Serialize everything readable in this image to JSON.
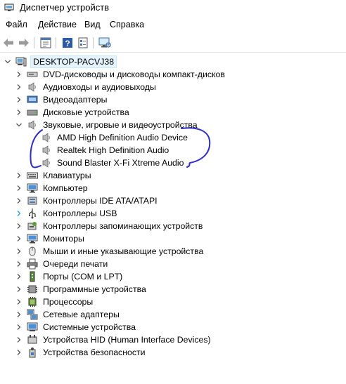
{
  "window": {
    "title": "Диспетчер устройств"
  },
  "menu": [
    {
      "label": "Файл"
    },
    {
      "label": "Действие"
    },
    {
      "label": "Вид"
    },
    {
      "label": "Справка"
    }
  ],
  "toolbar": {
    "buttons": [
      {
        "icon": "back-arrow-icon"
      },
      {
        "icon": "forward-arrow-icon"
      },
      {
        "icon": "properties-icon"
      },
      {
        "icon": "help-icon"
      },
      {
        "icon": "properties-sheet-icon"
      },
      {
        "icon": "monitor-scan-icon"
      }
    ]
  },
  "tree": {
    "root": {
      "label": "DESKTOP-PACVJ38",
      "icon": "computer-icon",
      "expanded": true,
      "selected": true
    },
    "items": [
      {
        "label": "DVD-дисководы и дисководы компакт-дисков",
        "icon": "dvd-drive-icon",
        "expanded": false
      },
      {
        "label": "Аудиовходы и аудиовыходы",
        "icon": "speaker-icon",
        "expanded": false
      },
      {
        "label": "Видеоадаптеры",
        "icon": "display-adapter-icon",
        "expanded": false
      },
      {
        "label": "Дисковые устройства",
        "icon": "disk-drive-icon",
        "expanded": false
      },
      {
        "label": "Звуковые, игровые и видеоустройства",
        "icon": "speaker-icon",
        "expanded": true,
        "children": [
          {
            "label": "AMD High Definition Audio Device",
            "icon": "speaker-icon"
          },
          {
            "label": "Realtek High Definition Audio",
            "icon": "speaker-icon"
          },
          {
            "label": "Sound Blaster X-Fi Xtreme Audio",
            "icon": "speaker-icon"
          }
        ]
      },
      {
        "label": "Клавиатуры",
        "icon": "keyboard-icon",
        "expanded": false
      },
      {
        "label": "Компьютер",
        "icon": "monitor-icon",
        "expanded": false
      },
      {
        "label": "Контроллеры IDE ATA/ATAPI",
        "icon": "ide-controller-icon",
        "expanded": false
      },
      {
        "label": "Контроллеры USB",
        "icon": "usb-icon",
        "expanded": false,
        "hover": true
      },
      {
        "label": "Контроллеры запоминающих устройств",
        "icon": "storage-controller-icon",
        "expanded": false
      },
      {
        "label": "Мониторы",
        "icon": "monitor-icon",
        "expanded": false
      },
      {
        "label": "Мыши и иные указывающие устройства",
        "icon": "mouse-icon",
        "expanded": false
      },
      {
        "label": "Очереди печати",
        "icon": "printer-icon",
        "expanded": false
      },
      {
        "label": "Порты (COM и LPT)",
        "icon": "port-icon",
        "expanded": false
      },
      {
        "label": "Программные устройства",
        "icon": "software-device-icon",
        "expanded": false
      },
      {
        "label": "Процессоры",
        "icon": "processor-icon",
        "expanded": false
      },
      {
        "label": "Сетевые адаптеры",
        "icon": "network-adapter-icon",
        "expanded": false
      },
      {
        "label": "Системные устройства",
        "icon": "system-device-icon",
        "expanded": false
      },
      {
        "label": "Устройства HID (Human Interface Devices)",
        "icon": "hid-icon",
        "expanded": false
      },
      {
        "label": "Устройства безопасности",
        "icon": "security-device-icon",
        "expanded": false
      }
    ]
  },
  "colors": {
    "selection": "#e5f3ff",
    "annotation": "#2d2dc8",
    "hover_chevron": "#1ea0d8"
  }
}
